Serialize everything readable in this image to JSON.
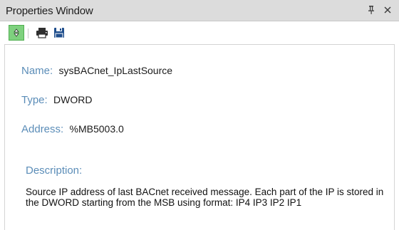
{
  "window": {
    "title": "Properties Window"
  },
  "toolbar": {
    "select_icon": "select-object-icon",
    "print_icon": "print-icon",
    "save_icon": "save-icon"
  },
  "properties": {
    "name_label": "Name:",
    "name_value": "sysBACnet_IpLastSource",
    "type_label": "Type:",
    "type_value": "DWORD",
    "address_label": "Address:",
    "address_value": "%MB5003.0",
    "description_label": "Description:",
    "description_value": "Source IP address of last BACnet received message. Each part of the IP is stored in the DWORD starting from the MSB using format: IP4 IP3 IP2 IP1"
  },
  "colors": {
    "label": "#5b8db8",
    "titlebar": "#dcdcdc",
    "select_active": "#7ed17e"
  }
}
